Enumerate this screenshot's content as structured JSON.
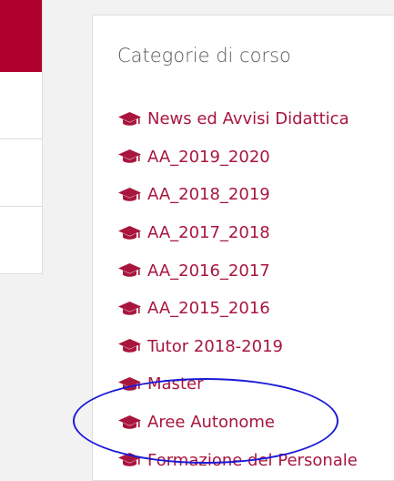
{
  "block": {
    "title": "Categorie di corso",
    "items": [
      {
        "label": "News ed Avvisi Didattica",
        "icon": "graduation-cap-icon"
      },
      {
        "label": "AA_2019_2020",
        "icon": "graduation-cap-icon"
      },
      {
        "label": "AA_2018_2019",
        "icon": "graduation-cap-icon"
      },
      {
        "label": "AA_2017_2018",
        "icon": "graduation-cap-icon"
      },
      {
        "label": "AA_2016_2017",
        "icon": "graduation-cap-icon"
      },
      {
        "label": "AA_2015_2016",
        "icon": "graduation-cap-icon"
      },
      {
        "label": "Tutor 2018-2019",
        "icon": "graduation-cap-icon"
      },
      {
        "label": "Master",
        "icon": "graduation-cap-icon"
      },
      {
        "label": "Aree Autonome",
        "icon": "graduation-cap-icon"
      },
      {
        "label": "Formazione del Personale",
        "icon": "graduation-cap-icon"
      }
    ]
  },
  "colors": {
    "link": "#a8163d",
    "accent": "#b0002c",
    "annotation": "#1a1ad6"
  }
}
